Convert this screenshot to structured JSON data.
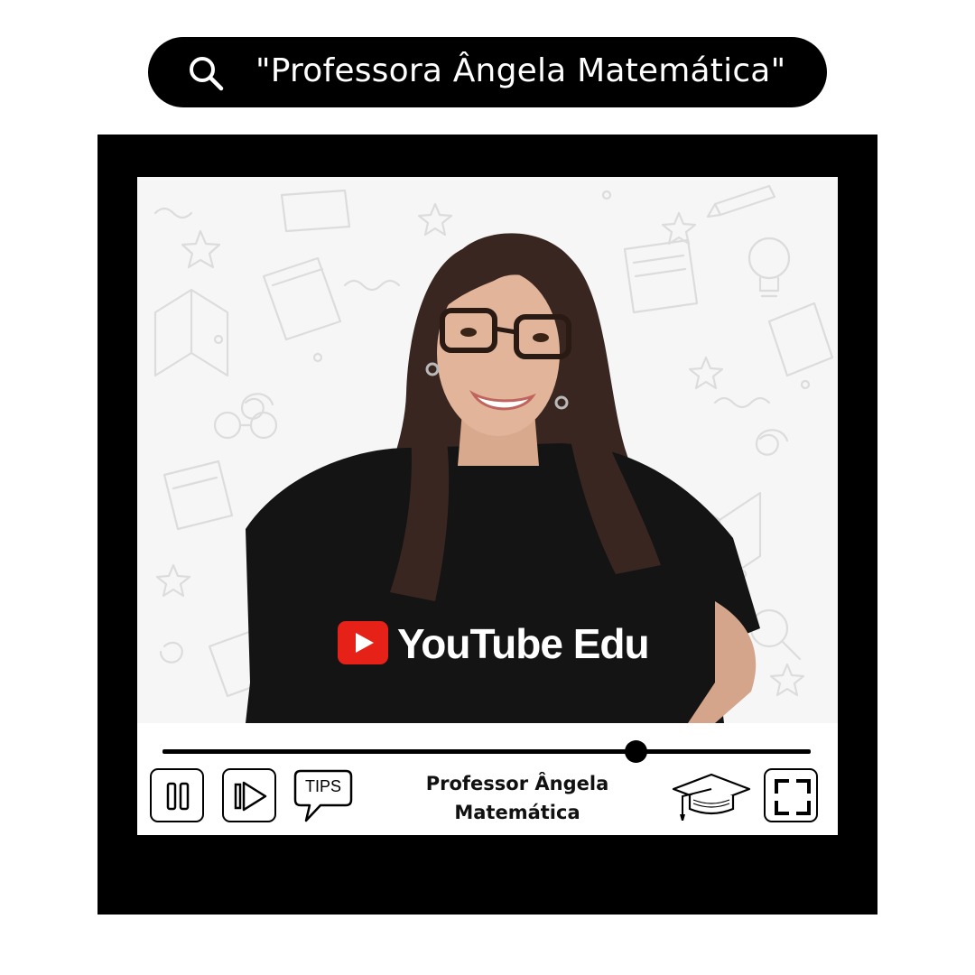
{
  "search": {
    "query": "\"Professora Ângela Matemática\""
  },
  "video": {
    "title_line1": "Professor Ângela",
    "title_line2": "Matemática",
    "shirt_logo_text": "YouTube Edu",
    "progress": 0.73
  },
  "controls": {
    "tips_label": "TIPS"
  },
  "colors": {
    "frame": "#000000",
    "youtube_red": "#e62117",
    "screen_bg": "#f6f6f6"
  },
  "icons": [
    "search-icon",
    "pause-icon",
    "next-icon",
    "tips-bubble-icon",
    "graduation-cap-icon",
    "fullscreen-icon"
  ]
}
